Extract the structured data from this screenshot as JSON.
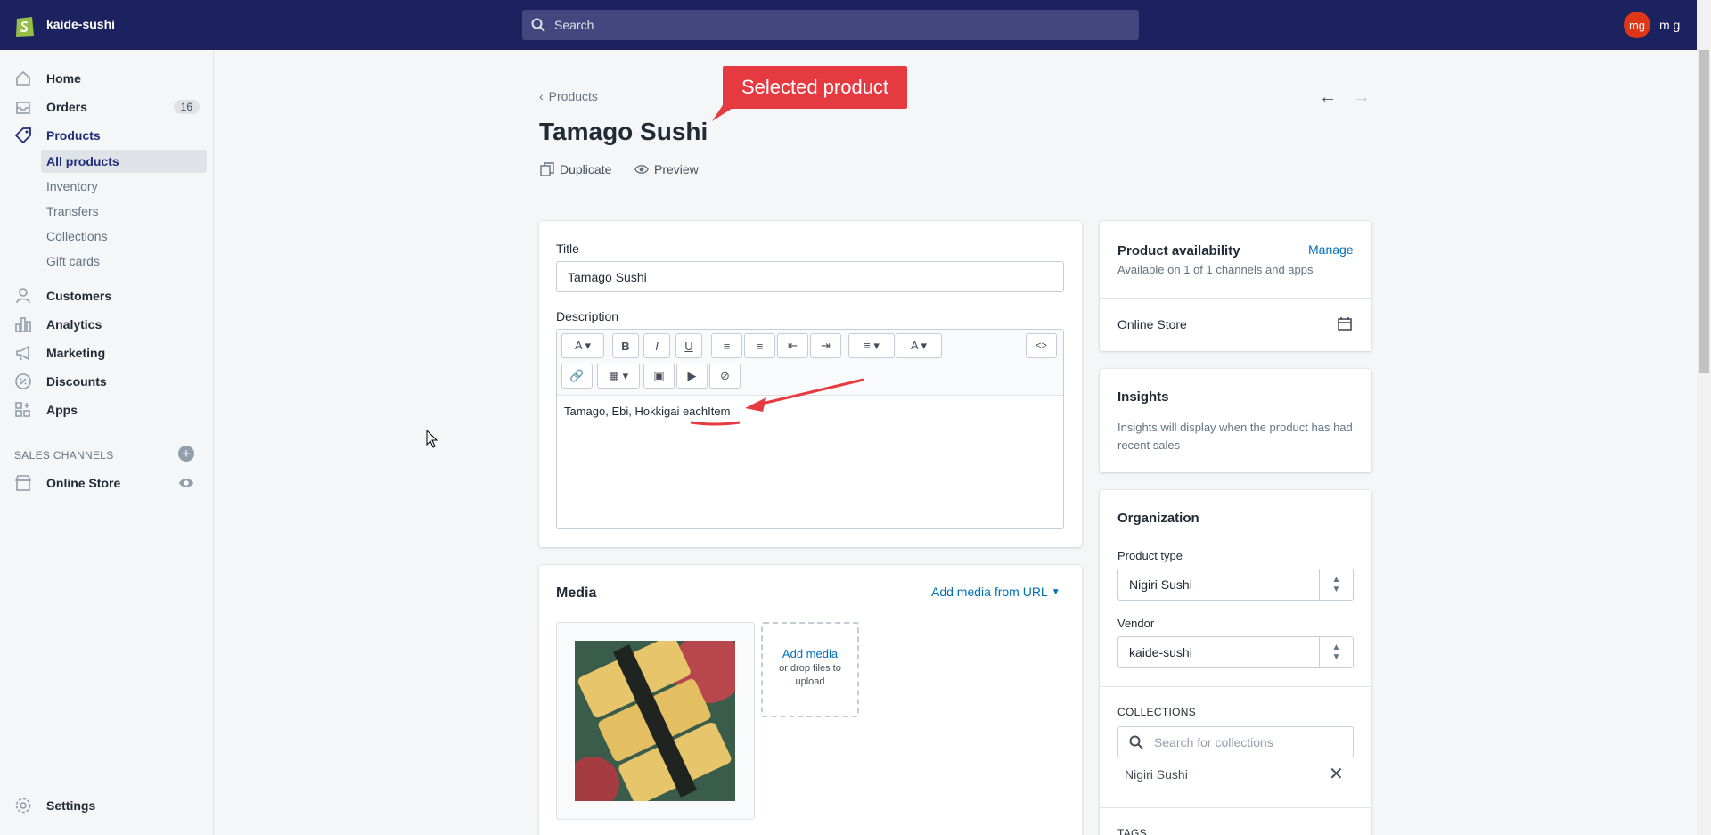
{
  "topbar": {
    "shop_name": "kaide-sushi",
    "search_placeholder": "Search",
    "avatar_initials": "mg",
    "user_name": "m g",
    "logo_icon": "shopify-bag-icon"
  },
  "sidebar": {
    "items": [
      {
        "label": "Home",
        "icon": "home-icon"
      },
      {
        "label": "Orders",
        "icon": "orders-icon",
        "badge": "16"
      },
      {
        "label": "Products",
        "icon": "tag-icon"
      },
      {
        "label": "Customers",
        "icon": "person-icon"
      },
      {
        "label": "Analytics",
        "icon": "bar-chart-icon"
      },
      {
        "label": "Marketing",
        "icon": "megaphone-icon"
      },
      {
        "label": "Discounts",
        "icon": "discount-icon"
      },
      {
        "label": "Apps",
        "icon": "apps-icon"
      }
    ],
    "product_subitems": [
      "All products",
      "Inventory",
      "Transfers",
      "Collections",
      "Gift cards"
    ],
    "channels_heading": "SALES CHANNELS",
    "online_store": "Online Store",
    "settings": "Settings"
  },
  "page": {
    "back_label": "Products",
    "title": "Tamago Sushi",
    "duplicate": "Duplicate",
    "preview": "Preview",
    "annotation": "Selected product"
  },
  "product_form": {
    "title_label": "Title",
    "title_value": "Tamago Sushi",
    "description_label": "Description",
    "description_text": "Tamago, Ebi, Hokkigai eachItem"
  },
  "media": {
    "heading": "Media",
    "add_from_url": "Add media from URL",
    "add_media": "Add media",
    "drop_hint": "or drop files to upload"
  },
  "availability": {
    "heading": "Product availability",
    "manage": "Manage",
    "subtitle": "Available on 1 of 1 channels and apps",
    "channel": "Online Store"
  },
  "insights": {
    "heading": "Insights",
    "text": "Insights will display when the product has had recent sales"
  },
  "organization": {
    "heading": "Organization",
    "product_type_label": "Product type",
    "product_type_value": "Nigiri Sushi",
    "vendor_label": "Vendor",
    "vendor_value": "kaide-sushi",
    "collections_label": "COLLECTIONS",
    "collections_placeholder": "Search for collections",
    "collection_tag": "Nigiri Sushi",
    "tags_label": "TAGS"
  },
  "colors": {
    "topbar": "#1c2260",
    "accent": "#006fbb",
    "annotation": "#e53a40"
  }
}
